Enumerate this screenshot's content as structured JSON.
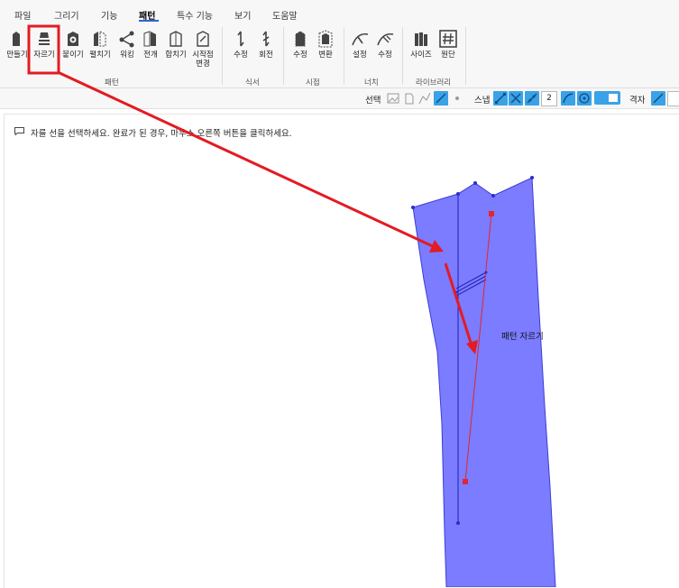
{
  "menu": {
    "items": [
      "파일",
      "그리기",
      "기능",
      "패턴",
      "특수 기능",
      "보기",
      "도움말"
    ],
    "active": "패턴"
  },
  "ribbon": {
    "pattern_group": {
      "label": "패턴",
      "tools": [
        "만들기",
        "자르기",
        "붙이기",
        "펼치기",
        "워킹",
        "전개",
        "합치기",
        "시작점\n변경"
      ]
    },
    "notch_group": {
      "label": "식서",
      "tools": [
        "수정",
        "회전"
      ]
    },
    "seam_group": {
      "label": "시접",
      "tools": [
        "수정",
        "변환"
      ]
    },
    "dart_group": {
      "label": "너치",
      "tools": [
        "설정",
        "수정"
      ]
    },
    "library_group": {
      "label": "라이브러리",
      "tools": [
        "사이즈",
        "원단"
      ]
    }
  },
  "toolbar": {
    "select_label": "선택",
    "snap_label": "스냅",
    "snap_value": "2",
    "grid_label": "격자"
  },
  "canvas": {
    "hint": "자를 선을 선택하세요. 완료가 된 경우, 마우스 오른쪽 버튼을 클릭하세요.",
    "tooltip": "패턴 자르기"
  },
  "colors": {
    "pattern_fill": "#7b7cff",
    "pattern_stroke": "#3d3dd6",
    "cut_line": "#e2262e",
    "annotation": "#e31b23",
    "accent": "#3aa2e6"
  }
}
